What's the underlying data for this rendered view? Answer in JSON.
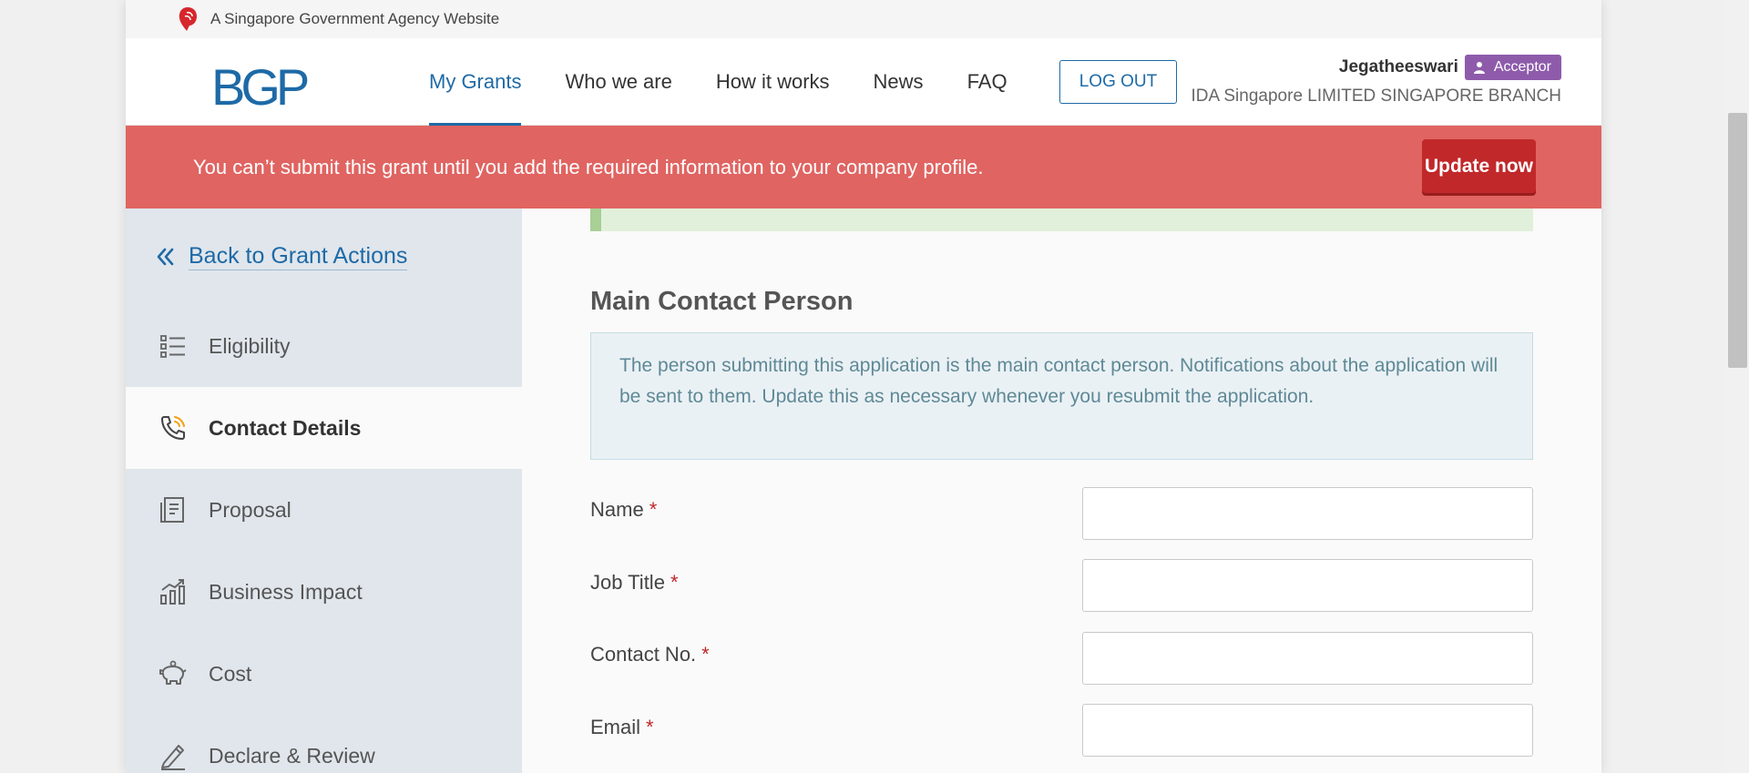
{
  "gov_bar": {
    "text": "A Singapore Government Agency Website"
  },
  "header": {
    "logo": "BGP",
    "nav": [
      {
        "label": "My Grants",
        "active": true
      },
      {
        "label": "Who we are",
        "active": false
      },
      {
        "label": "How it works",
        "active": false
      },
      {
        "label": "News",
        "active": false
      },
      {
        "label": "FAQ",
        "active": false
      }
    ],
    "logout_label": "LOG OUT",
    "user_name": "Jegatheeswari",
    "role": "Acceptor",
    "organization": "IDA Singapore LIMITED SINGAPORE BRANCH"
  },
  "alert": {
    "message": "You can’t submit this grant until you add the required information to your company profile.",
    "button": "Update now",
    "color": "#e06461"
  },
  "sidebar": {
    "back_label": "Back to Grant Actions",
    "items": [
      {
        "label": "Eligibility",
        "icon": "list-icon",
        "active": false
      },
      {
        "label": "Contact Details",
        "icon": "phone-icon",
        "active": true
      },
      {
        "label": "Proposal",
        "icon": "document-icon",
        "active": false
      },
      {
        "label": "Business Impact",
        "icon": "chart-icon",
        "active": false
      },
      {
        "label": "Cost",
        "icon": "piggy-bank-icon",
        "active": false
      },
      {
        "label": "Declare & Review",
        "icon": "pen-icon",
        "active": false
      }
    ]
  },
  "main": {
    "section_title": "Main Contact Person",
    "info": "The person submitting this application is the main contact person. Notifications about the application will be sent to them. Update this as necessary whenever you resubmit the application.",
    "fields": [
      {
        "label": "Name",
        "value": ""
      },
      {
        "label": "Job Title",
        "value": ""
      },
      {
        "label": "Contact No.",
        "value": ""
      },
      {
        "label": "Email",
        "value": ""
      }
    ],
    "required_marker": "*"
  },
  "colors": {
    "brand": "#1e6aa6",
    "role_badge": "#8e5bab",
    "update_button": "#c1282a"
  }
}
